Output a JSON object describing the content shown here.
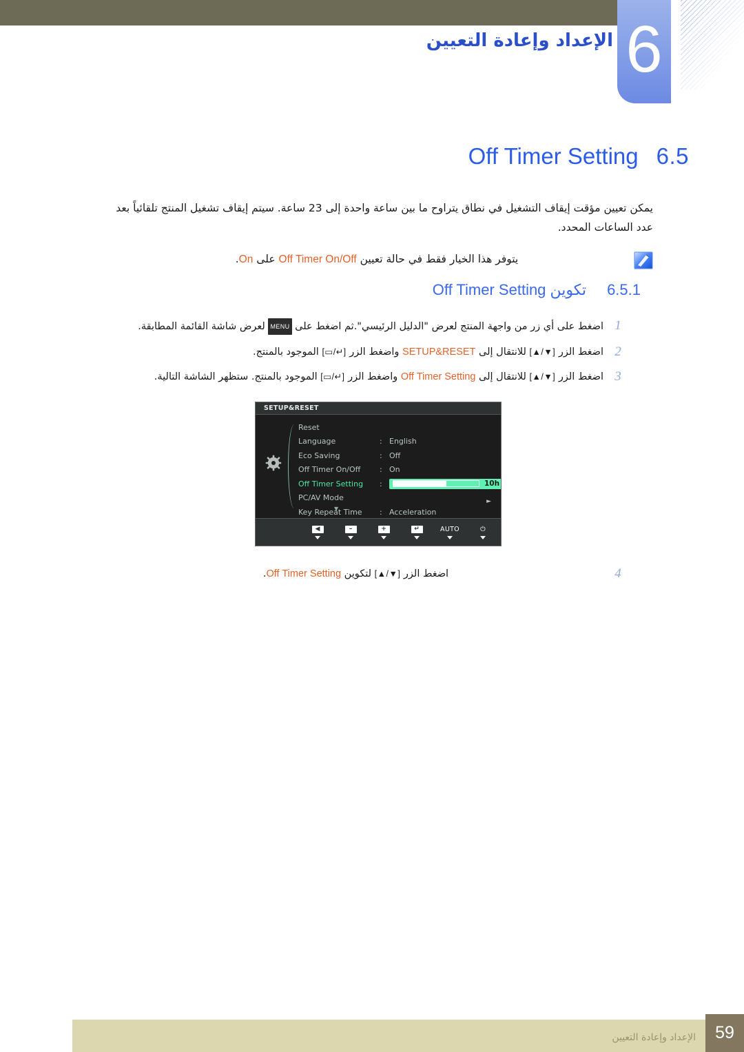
{
  "colors": {
    "header_band": "#6d6b56",
    "chapter_badge_blue": "#8ea7e8",
    "heading_blue": "#2a5ce8",
    "chapter_title_blue": "#2a4fc8",
    "highlight_orange": "#e4622a",
    "footer_beige": "#ddd7b0",
    "footer_pagebox_brown": "#83785f",
    "osd_background": "#1c1c1c",
    "osd_selected_green": "#4fe6a8",
    "osd_slider_green": "#62efb4"
  },
  "header": {
    "chapter_number": "6",
    "chapter_title": "الإعداد وإعادة التعيين"
  },
  "section": {
    "number": "6.5",
    "name": "Off Timer Setting"
  },
  "intro": {
    "paragraph": "يمكن تعيين مؤقت إيقاف التشغيل في نطاق يتراوح ما بين ساعة واحدة إلى 23 ساعة. سيتم إيقاف تشغيل المنتج تلقائياً بعد عدد الساعات المحدد."
  },
  "note": {
    "icon": "note-pencil-icon",
    "text_before": "يتوفر هذا الخيار فقط في حالة تعيين",
    "highlight_1": "Off Timer On/Off",
    "text_middle": "على",
    "highlight_2": "On",
    "text_after": "."
  },
  "subsection": {
    "number": "6.5.1",
    "name_arabic": "تكوين",
    "name_english": "Off Timer Setting"
  },
  "steps": [
    {
      "num": "1",
      "text_a": "اضغط على أي زر من واجهة المنتج لعرض \"الدليل الرئيسي\".ثم اضغط على",
      "key": "MENU",
      "text_b": "لعرض شاشة القائمة المطابقة."
    },
    {
      "num": "2",
      "text_a": "اضغط الزر",
      "key_updown": "[▲/▼]",
      "text_b": "للانتقال إلى",
      "highlight": "SETUP&RESET",
      "text_c": "واضغط الزر",
      "key_enter": "[▭/↵]",
      "text_d": "الموجود بالمنتج."
    },
    {
      "num": "3",
      "text_a": "اضغط الزر",
      "key_updown": "[▲/▼]",
      "text_b": "للانتقال إلى",
      "highlight": "Off Timer Setting",
      "text_c": "واضغط الزر",
      "key_enter": "[▭/↵]",
      "text_d": "الموجود بالمنتج. ستظهر الشاشة التالية."
    },
    {
      "num": "4",
      "text_a": "اضغط الزر",
      "key_updown": "[▲/▼]",
      "text_b": "لتكوين",
      "highlight": "Off Timer Setting",
      "text_c": "."
    }
  ],
  "osd": {
    "title": "SETUP&RESET",
    "gear_icon": "gear-icon",
    "items": [
      {
        "label": "Reset",
        "colon": "",
        "value": "",
        "selected": false,
        "type": "plain"
      },
      {
        "label": "Language",
        "colon": ":",
        "value": "English",
        "selected": false,
        "type": "plain"
      },
      {
        "label": "Eco Saving",
        "colon": ":",
        "value": "Off",
        "selected": false,
        "type": "plain"
      },
      {
        "label": "Off Timer On/Off",
        "colon": ":",
        "value": "On",
        "selected": false,
        "type": "plain"
      },
      {
        "label": "Off Timer Setting",
        "colon": ":",
        "value": "10h",
        "selected": true,
        "type": "slider",
        "fill_percent": 62
      },
      {
        "label": "PC/AV Mode",
        "colon": "",
        "value": "",
        "selected": false,
        "type": "submenu",
        "arrow": "►"
      },
      {
        "label": "Key Repeat Time",
        "colon": ":",
        "value": "Acceleration",
        "selected": false,
        "type": "plain"
      }
    ],
    "scroll_indicator": "▼",
    "buttons": [
      {
        "name": "back-button",
        "glyph": "◀",
        "style": "chip"
      },
      {
        "name": "minus-button",
        "glyph": "–",
        "style": "chip"
      },
      {
        "name": "plus-button",
        "glyph": "+",
        "style": "chip"
      },
      {
        "name": "enter-button",
        "glyph": "↵",
        "style": "chip"
      },
      {
        "name": "auto-button",
        "glyph": "AUTO",
        "style": "text"
      },
      {
        "name": "power-button",
        "glyph": "⏻",
        "style": "text"
      }
    ]
  },
  "footer": {
    "chapter_label": "الإعداد وإعادة التعيين",
    "page_number": "59"
  }
}
